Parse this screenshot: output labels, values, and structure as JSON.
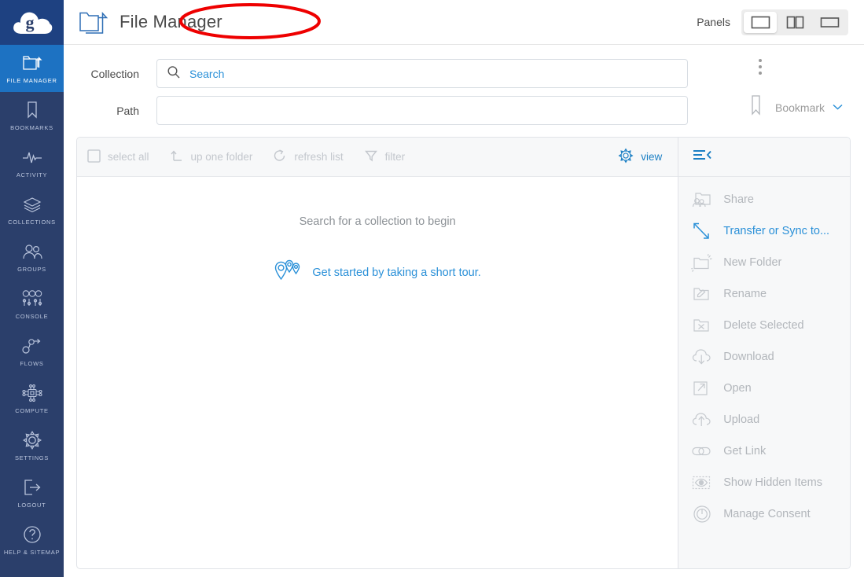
{
  "app": {
    "logo_alt": "cloud-g-logo"
  },
  "sidebar": {
    "items": [
      {
        "label": "FILE MANAGER",
        "icon": "folder-icon",
        "active": true
      },
      {
        "label": "BOOKMARKS",
        "icon": "bookmark-icon",
        "active": false
      },
      {
        "label": "ACTIVITY",
        "icon": "pulse-icon",
        "active": false
      },
      {
        "label": "COLLECTIONS",
        "icon": "layers-icon",
        "active": false
      },
      {
        "label": "GROUPS",
        "icon": "people-icon",
        "active": false
      },
      {
        "label": "CONSOLE",
        "icon": "sliders-icon",
        "active": false
      },
      {
        "label": "FLOWS",
        "icon": "flow-nodes-icon",
        "active": false
      },
      {
        "label": "COMPUTE",
        "icon": "chip-icon",
        "active": false
      },
      {
        "label": "SETTINGS",
        "icon": "gear-icon",
        "active": false
      },
      {
        "label": "LOGOUT",
        "icon": "exit-icon",
        "active": false
      },
      {
        "label": "HELP & SITEMAP",
        "icon": "question-icon",
        "active": false
      }
    ]
  },
  "header": {
    "title": "File Manager",
    "icon": "copy-folder-icon",
    "panels_label": "Panels",
    "panel_buttons": [
      {
        "name": "single-panel",
        "selected": true
      },
      {
        "name": "dual-panel",
        "selected": false
      },
      {
        "name": "wide-panel",
        "selected": false
      }
    ]
  },
  "form": {
    "collection_label": "Collection",
    "collection_placeholder": "Search",
    "collection_value": "",
    "path_label": "Path",
    "path_placeholder": "",
    "path_value": "",
    "bookmark_label": "Bookmark",
    "kebab_name": "more-options"
  },
  "toolbar": {
    "select_all": "select all",
    "up_one_folder": "up one folder",
    "refresh_list": "refresh list",
    "filter": "filter",
    "view": "view",
    "collapse_name": "collapse-panel"
  },
  "content": {
    "empty_message": "Search for a collection to begin",
    "tour_link": "Get started by taking a short tour."
  },
  "actions": [
    {
      "label": "Share",
      "icon": "share-folder-icon",
      "enabled": false
    },
    {
      "label": "Transfer or Sync to...",
      "icon": "transfer-arrow-icon",
      "enabled": true
    },
    {
      "label": "New Folder",
      "icon": "new-folder-icon",
      "enabled": false
    },
    {
      "label": "Rename",
      "icon": "rename-pencil-icon",
      "enabled": false
    },
    {
      "label": "Delete Selected",
      "icon": "delete-x-icon",
      "enabled": false
    },
    {
      "label": "Download",
      "icon": "download-cloud-icon",
      "enabled": false
    },
    {
      "label": "Open",
      "icon": "open-external-icon",
      "enabled": false
    },
    {
      "label": "Upload",
      "icon": "upload-cloud-icon",
      "enabled": false
    },
    {
      "label": "Get Link",
      "icon": "link-icon",
      "enabled": false
    },
    {
      "label": "Show Hidden Items",
      "icon": "eye-icon",
      "enabled": false
    },
    {
      "label": "Manage Consent",
      "icon": "power-icon",
      "enabled": false
    }
  ],
  "annotation": {
    "type": "red-ellipse",
    "color": "#ee0000",
    "target": "File Manager"
  },
  "colors": {
    "sidebar_bg": "#2b3f6b",
    "sidebar_active": "#1d72c2",
    "logo_bg": "#1e4181",
    "accent": "#2a90d8",
    "disabled_text": "#b2b6bb"
  }
}
